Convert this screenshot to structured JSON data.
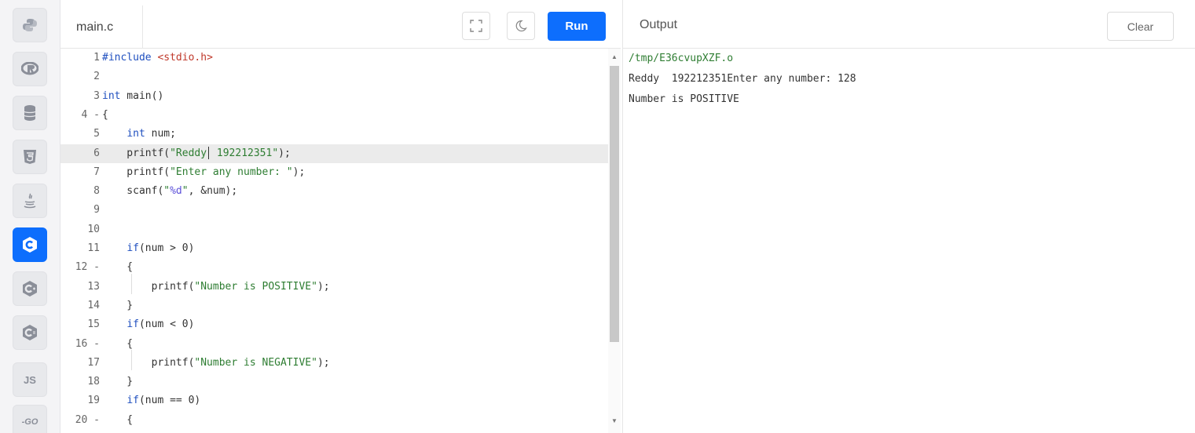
{
  "sidebar": {
    "languages": [
      {
        "name": "python",
        "label": "",
        "active": false
      },
      {
        "name": "r",
        "label": "",
        "active": false
      },
      {
        "name": "sql",
        "label": "",
        "active": false
      },
      {
        "name": "html",
        "label": "",
        "active": false
      },
      {
        "name": "java",
        "label": "",
        "active": false
      },
      {
        "name": "c",
        "label": "",
        "active": true
      },
      {
        "name": "cpp",
        "label": "",
        "active": false
      },
      {
        "name": "csharp",
        "label": "",
        "active": false
      },
      {
        "name": "javascript",
        "label": "JS",
        "active": false
      },
      {
        "name": "go",
        "label": "-GO",
        "active": false
      }
    ]
  },
  "editor": {
    "file_name": "main.c",
    "run_label": "Run",
    "lines": [
      {
        "num": "1",
        "text": "#include <stdio.h>"
      },
      {
        "num": "2",
        "text": ""
      },
      {
        "num": "3",
        "text": "int main()"
      },
      {
        "num": "4 -",
        "text": "{"
      },
      {
        "num": "5",
        "text": "    int num;"
      },
      {
        "num": "6",
        "text": "    printf(\"Reddy  192212351\");"
      },
      {
        "num": "7",
        "text": "    printf(\"Enter any number: \");"
      },
      {
        "num": "8",
        "text": "    scanf(\"%d\", &num);"
      },
      {
        "num": "9",
        "text": ""
      },
      {
        "num": "10",
        "text": ""
      },
      {
        "num": "11",
        "text": "    if(num > 0)"
      },
      {
        "num": "12 -",
        "text": "    {"
      },
      {
        "num": "13",
        "text": "        printf(\"Number is POSITIVE\");"
      },
      {
        "num": "14",
        "text": "    }"
      },
      {
        "num": "15",
        "text": "    if(num < 0)"
      },
      {
        "num": "16 -",
        "text": "    {"
      },
      {
        "num": "17",
        "text": "        printf(\"Number is NEGATIVE\");"
      },
      {
        "num": "18",
        "text": "    }"
      },
      {
        "num": "19",
        "text": "    if(num == 0)"
      },
      {
        "num": "20 -",
        "text": "    {"
      }
    ]
  },
  "output": {
    "title": "Output",
    "clear_label": "Clear",
    "lines": [
      "/tmp/E36cvupXZF.o",
      "Reddy  192212351Enter any number: 128",
      "Number is POSITIVE"
    ]
  },
  "colors": {
    "accent": "#0d6efd",
    "keyword": "#1f4fbf",
    "string": "#2e7d32",
    "header": "#c0392b"
  }
}
